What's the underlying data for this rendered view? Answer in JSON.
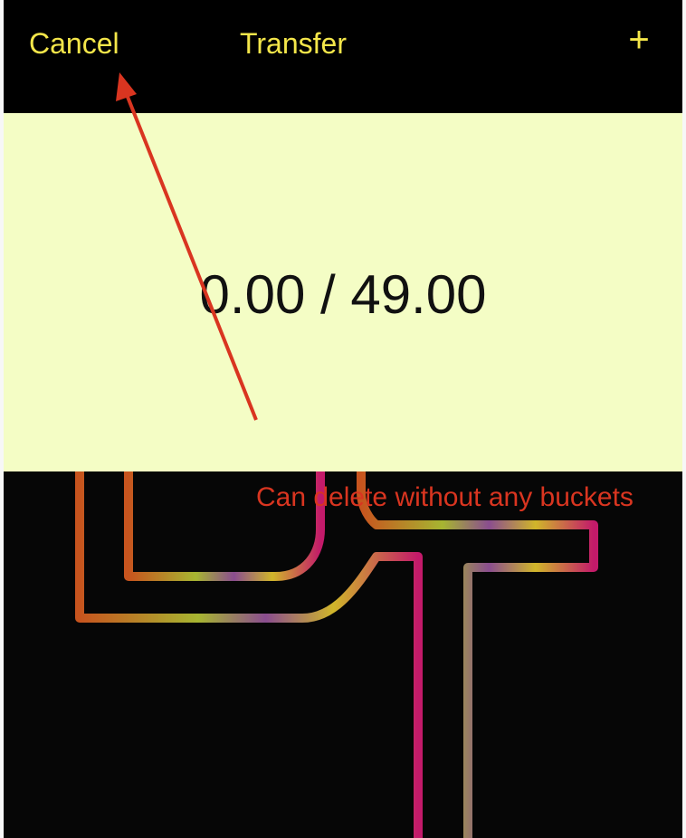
{
  "nav": {
    "cancel_label": "Cancel",
    "title": "Transfer",
    "add_label": "+"
  },
  "panel": {
    "amount": "0.00 / 49.00"
  },
  "annotation": {
    "text": "Can delete without any buckets",
    "color": "#d93520"
  },
  "colors": {
    "nav_background": "#000000",
    "nav_text": "#f4e64a",
    "panel_background": "#f4fdc5",
    "amount_text": "#111111"
  },
  "icons": {
    "logo": "dt-logo-icon",
    "annotation_arrow": "red-arrow-icon"
  }
}
